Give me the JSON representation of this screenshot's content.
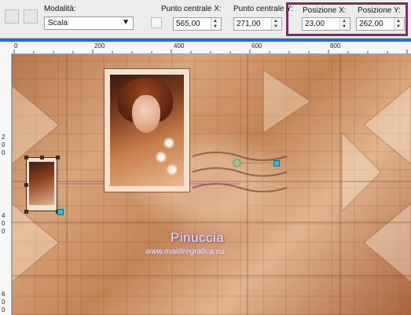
{
  "toolbar": {
    "mode_label": "Modalità:",
    "mode_value": "Scala",
    "center_x_label": "Punto centrale X:",
    "center_x_value": "565,00",
    "center_y_label": "Punto centrale Y:",
    "center_y_value": "271,00",
    "pos_x_label": "Posizione X:",
    "pos_x_value": "23,00",
    "pos_y_label": "Posizione Y:",
    "pos_y_value": "262,00"
  },
  "ruler_top": [
    "0",
    "200",
    "400",
    "600",
    "800"
  ],
  "ruler_left": [
    "2",
    "0",
    "0",
    "4",
    "0",
    "0",
    "6",
    "0",
    "0"
  ],
  "watermark": {
    "name": "Pinuccia",
    "url": "www.maidiregrafica.eu"
  },
  "colors": {
    "highlight": "#7a2d5e",
    "accent": "#1f6fd1",
    "pivot": "#4fbf8f",
    "handle_line": "#22c3d9"
  },
  "icons": [
    "deform-tool-icon",
    "pick-tool-icon",
    "center-point-icon"
  ]
}
